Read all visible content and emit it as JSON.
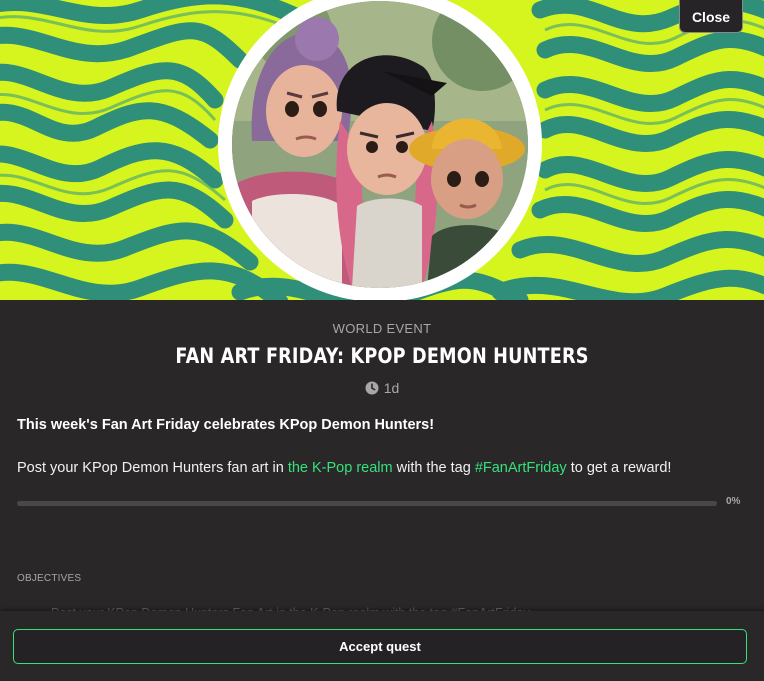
{
  "header": {
    "close_label": "Close"
  },
  "event": {
    "category": "WORLD EVENT",
    "title": "FAN ART FRIDAY: KPOP DEMON HUNTERS",
    "duration": "1d",
    "headline": "This week's Fan Art Friday celebrates KPop Demon Hunters!",
    "body_prefix": "Post your KPop Demon Hunters fan art in ",
    "realm_link": "the K-Pop realm",
    "body_middle": " with the tag ",
    "tag_link": "#FanArtFriday",
    "body_suffix": " to get a reward!"
  },
  "progress": {
    "percent_label": "0%",
    "fraction": 0
  },
  "objectives": {
    "label": "OBJECTIVES",
    "items": [
      {
        "text": "Post your KPop Demon Hunters Fan Art in the K-Pop realm with the tag #FanArtFriday"
      }
    ]
  },
  "footer": {
    "accept_label": "Accept quest"
  },
  "colors": {
    "accent": "#35e27a",
    "background": "#2a2729",
    "banner_lime": "#d8f51f",
    "banner_teal": "#2f8f79"
  },
  "icons": {
    "duration": "clock-icon"
  }
}
